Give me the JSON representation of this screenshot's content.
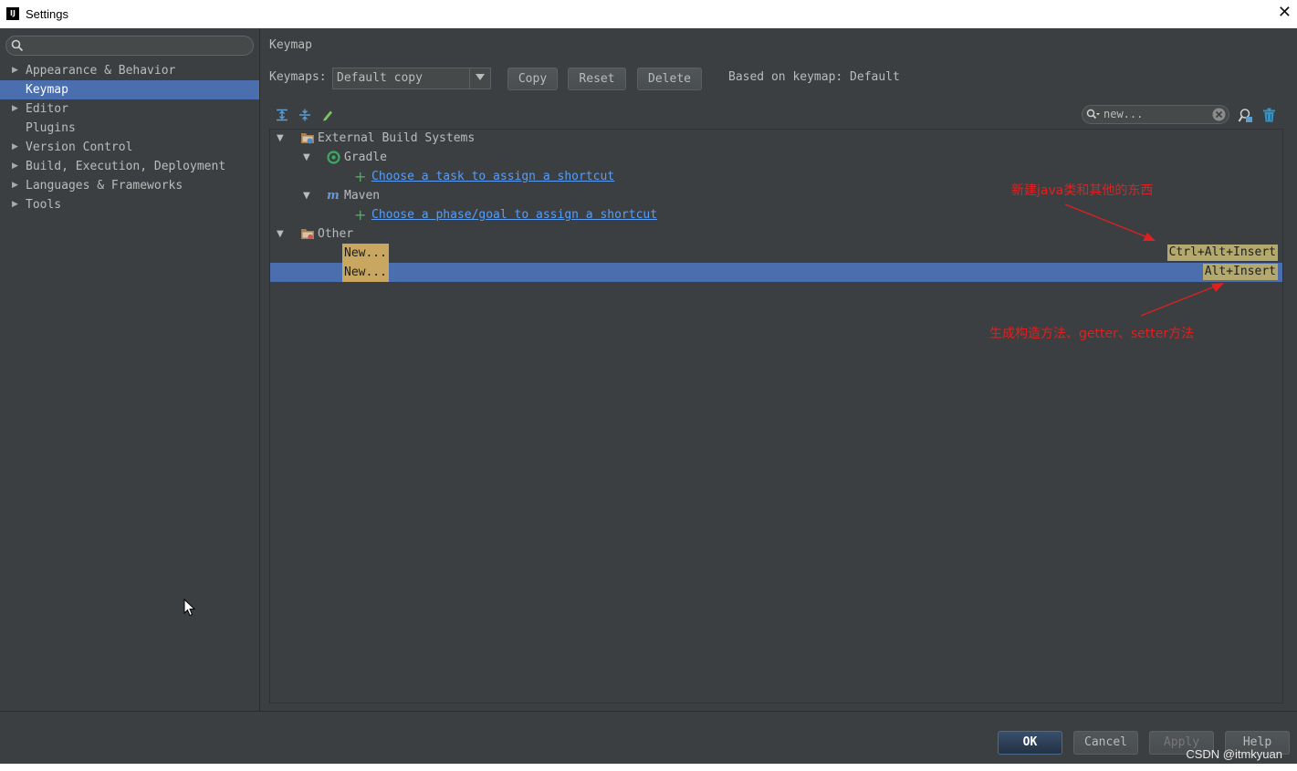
{
  "window": {
    "title": "Settings",
    "app_icon": "IJ"
  },
  "sidebar": {
    "search_value": "",
    "items": [
      {
        "label": "Appearance & Behavior",
        "expandable": true,
        "selected": false
      },
      {
        "label": "Keymap",
        "expandable": false,
        "selected": true
      },
      {
        "label": "Editor",
        "expandable": true,
        "selected": false
      },
      {
        "label": "Plugins",
        "expandable": false,
        "selected": false
      },
      {
        "label": "Version Control",
        "expandable": true,
        "selected": false
      },
      {
        "label": "Build, Execution, Deployment",
        "expandable": true,
        "selected": false
      },
      {
        "label": "Languages & Frameworks",
        "expandable": true,
        "selected": false
      },
      {
        "label": "Tools",
        "expandable": true,
        "selected": false
      }
    ]
  },
  "keymap": {
    "section_title": "Keymap",
    "keymaps_label": "Keymaps:",
    "selected_keymap": "Default copy",
    "copy_label": "Copy",
    "reset_label": "Reset",
    "delete_label": "Delete",
    "based_on": "Based on keymap: Default",
    "filter_value": "new..."
  },
  "tree": {
    "external_build": "External Build Systems",
    "gradle": "Gradle",
    "gradle_link": "Choose a task to assign a shortcut",
    "maven": "Maven",
    "maven_link": "Choose a phase/goal to assign a shortcut",
    "other": "Other",
    "rows": [
      {
        "action": "New...",
        "shortcut": "Ctrl+Alt+Insert",
        "selected": false
      },
      {
        "action": "New...",
        "shortcut": "Alt+Insert",
        "selected": true
      }
    ]
  },
  "annotations": {
    "top": "新建java类和其他的东西",
    "bottom": "生成构造方法、getter、setter方法"
  },
  "footer": {
    "ok_label": "OK",
    "cancel_label": "Cancel",
    "apply_label": "Apply",
    "help_label": "Help"
  },
  "watermark": "CSDN @itmkyuan",
  "colors": {
    "background": "#3c3f41",
    "selection": "#4b6eaf",
    "link": "#589df6",
    "annotation": "#e02020",
    "highlight": "#c9a760"
  }
}
